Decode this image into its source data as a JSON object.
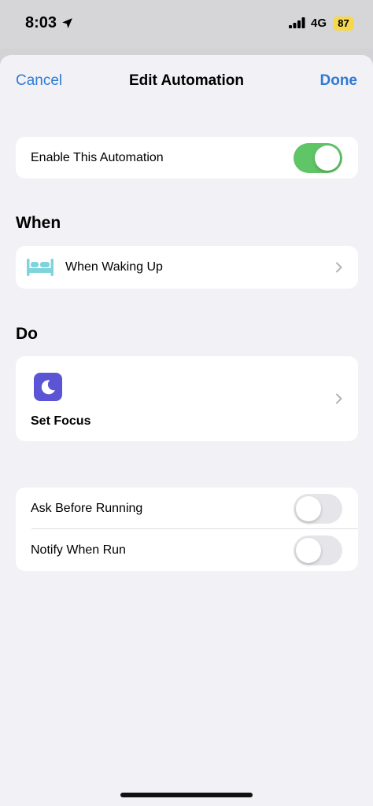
{
  "status_bar": {
    "time": "8:03",
    "network": "4G",
    "battery": "87"
  },
  "nav": {
    "cancel_label": "Cancel",
    "title": "Edit Automation",
    "done_label": "Done"
  },
  "enable_row": {
    "label": "Enable This Automation",
    "enabled": true
  },
  "when_section": {
    "header": "When",
    "trigger_label": "When Waking Up",
    "icon": "bed-icon"
  },
  "do_section": {
    "header": "Do",
    "action_label": "Set Focus",
    "icon": "moon-icon"
  },
  "options": [
    {
      "label": "Ask Before Running",
      "enabled": false
    },
    {
      "label": "Notify When Run",
      "enabled": false
    }
  ],
  "colors": {
    "accent": "#2f7ad3",
    "toggle_on": "#5fc566",
    "focus_icon_bg": "#5b55d6",
    "bed_icon": "#7fd4dc",
    "battery_badge": "#f5d84e"
  }
}
